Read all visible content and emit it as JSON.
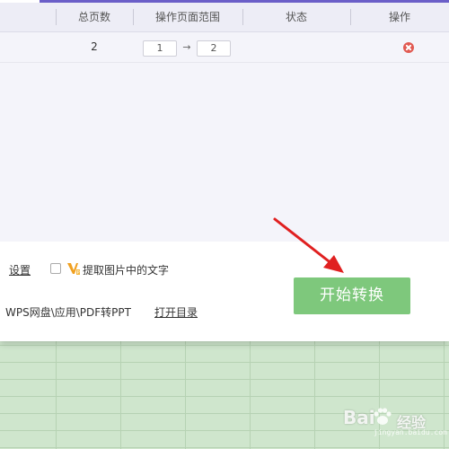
{
  "table": {
    "headers": {
      "pages": "总页数",
      "range": "操作页面范围",
      "status": "状态",
      "action": "操作"
    },
    "rows": [
      {
        "pages": "2",
        "range_from": "1",
        "range_to": "2",
        "status": ""
      }
    ],
    "range_arrow": "→"
  },
  "footer": {
    "settings_label": "设置",
    "extract_text_label": "提取图片中的文字",
    "extract_text_checked": false,
    "output_path": "WPS网盘\\应用\\PDF转PPT",
    "open_dir_label": "打开目录",
    "start_button_label": "开始转换"
  },
  "watermark": {
    "brand": "Bai",
    "suffix": "经验",
    "url": "jingyan.baidu.com"
  },
  "colors": {
    "accent_purple": "#6b5fc8",
    "start_button_green": "#7ec87c",
    "delete_red": "#e15a52",
    "annotation_arrow_red": "#e02020",
    "sheet_background": "#cfe6cd"
  },
  "icons": {
    "delete": "close-circle-icon",
    "vip": "vip-badge-icon",
    "checkbox": "checkbox-icon",
    "annotation": "red-arrow-annotation"
  }
}
